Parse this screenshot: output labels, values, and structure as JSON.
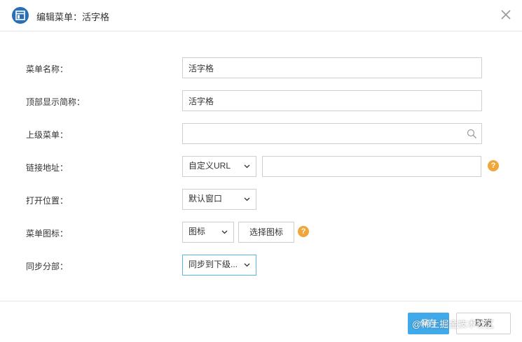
{
  "dialog": {
    "title": "编辑菜单：活字格",
    "icon": "window-icon",
    "close_icon": "close-icon"
  },
  "form": {
    "menu_name": {
      "label": "菜单名称：",
      "value": "活字格"
    },
    "short_name": {
      "label": "顶部显示简称：",
      "value": "活字格"
    },
    "parent_menu": {
      "label": "上级菜单：",
      "value": "",
      "icon": "search-icon"
    },
    "link": {
      "label": "链接地址：",
      "type_value": "自定义URL",
      "url_value": "",
      "help": "?"
    },
    "open_position": {
      "label": "打开位置：",
      "value": "默认窗口"
    },
    "menu_icon": {
      "label": "菜单图标：",
      "value": "图标",
      "choose_button": "选择图标",
      "help": "?"
    },
    "sync": {
      "label": "同步分部：",
      "value": "同步到下级..."
    }
  },
  "footer": {
    "save_label": "保存",
    "cancel_label": "取消",
    "watermark": "@稀土掘金技术社区"
  },
  "colors": {
    "primary": "#3fa9ea",
    "help": "#f0a63a",
    "title_icon": "#2a6fb5",
    "focus_border": "#5bb6e6"
  }
}
